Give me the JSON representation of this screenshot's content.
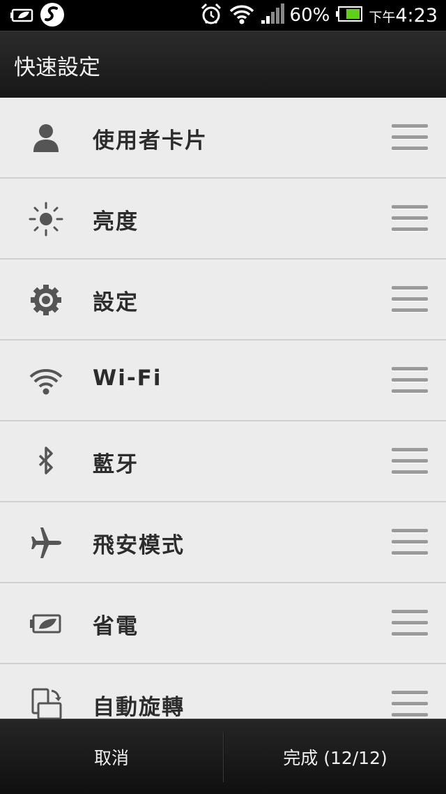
{
  "status_bar": {
    "icons_left": [
      "battery-saver-icon",
      "sense-icon"
    ],
    "icons_right": [
      "alarm-icon",
      "wifi-icon",
      "signal-icon",
      "battery-icon"
    ],
    "battery_percent": "60%",
    "time_prefix": "下午",
    "time": "4:23"
  },
  "header": {
    "title": "快速設定"
  },
  "quick_settings": [
    {
      "label": "使用者卡片",
      "icon": "person-icon"
    },
    {
      "label": "亮度",
      "icon": "brightness-icon"
    },
    {
      "label": "設定",
      "icon": "gear-icon"
    },
    {
      "label": "Wi-Fi",
      "icon": "wifi-icon"
    },
    {
      "label": "藍牙",
      "icon": "bluetooth-icon"
    },
    {
      "label": "飛安模式",
      "icon": "airplane-icon"
    },
    {
      "label": "省電",
      "icon": "power-saver-icon"
    },
    {
      "label": "自動旋轉",
      "icon": "auto-rotate-icon"
    }
  ],
  "footer": {
    "cancel_label": "取消",
    "done_label": "完成 (12/12)"
  },
  "colors": {
    "list_background": "#ececec",
    "divider": "#cfcfcf",
    "icon_gray": "#555555",
    "label_text": "#2c2c2c",
    "bar_background": "#1b1b1b"
  }
}
